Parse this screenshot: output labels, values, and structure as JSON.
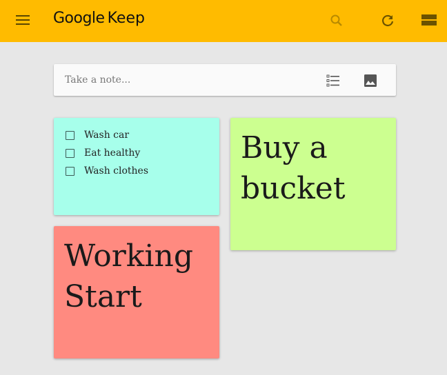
{
  "header": {
    "brand_google": "Google",
    "brand_keep": "Keep",
    "icons": [
      "menu-icon",
      "search-icon",
      "refresh-icon",
      "layout-icon"
    ]
  },
  "colors": {
    "header_bg": "#ffbb00",
    "page_bg": "#e7e7e7",
    "note_teal": "#a7ffeb",
    "note_green": "#ccff90",
    "note_red": "#ff8a80"
  },
  "composer": {
    "placeholder": "Take a note...",
    "value": "",
    "icons": [
      "new-list-icon",
      "new-image-icon"
    ]
  },
  "notes": [
    {
      "type": "checklist",
      "color": "#a7ffeb",
      "items": [
        {
          "label": "Wash car",
          "checked": false
        },
        {
          "label": "Eat healthy",
          "checked": false
        },
        {
          "label": "Wash clothes",
          "checked": false
        }
      ]
    },
    {
      "type": "text",
      "color": "#ccff90",
      "lines": [
        "Buy a",
        "bucket"
      ]
    },
    {
      "type": "text",
      "color": "#ff8a80",
      "lines": [
        "Working",
        "Start"
      ]
    }
  ]
}
